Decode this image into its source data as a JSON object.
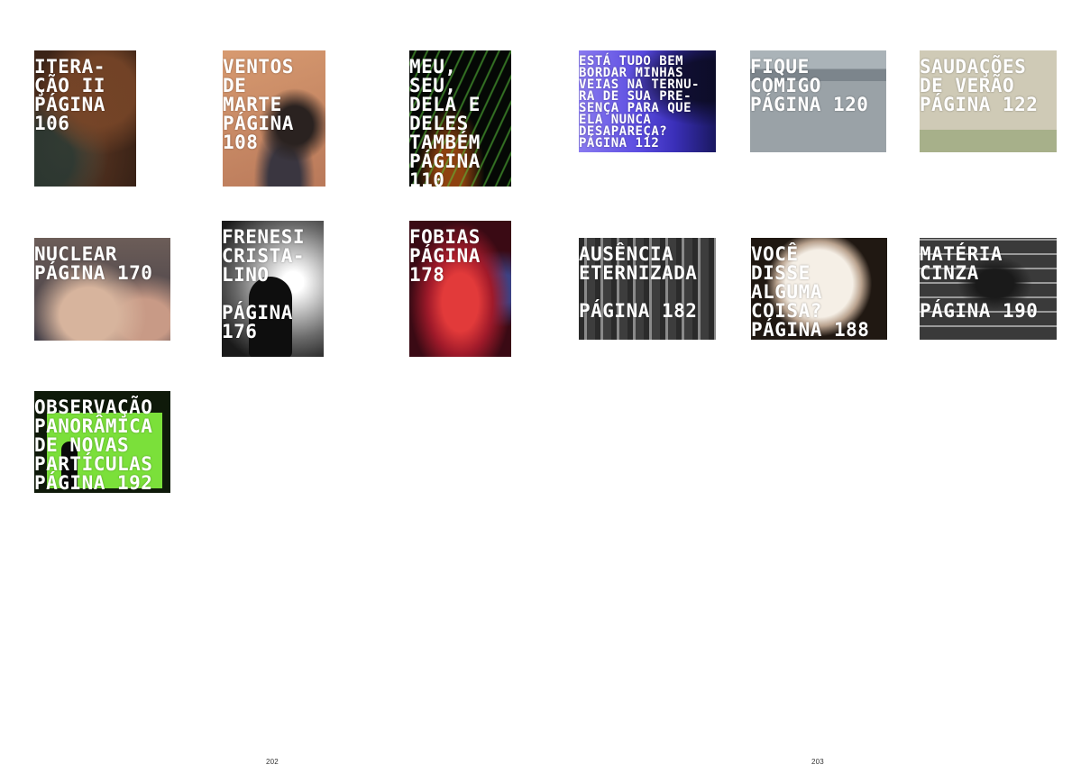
{
  "spread": {
    "page_left": "202",
    "page_right": "203"
  },
  "tiles": [
    {
      "caption": "ITERA-\nÇÃO II\nPÁGINA\n106",
      "image": "woman-drinking-photo"
    },
    {
      "caption": "VENTOS\nDE\nMARTE\nPÁGINA\n108",
      "image": "person-sitting-on-sand-photo"
    },
    {
      "caption": "MEU,\nSEU,\nDELA E\nDELES\nTAMBÉM\nPÁGINA\n110",
      "image": "green-light-streaks-photo"
    },
    {
      "caption": "ESTÁ TUDO BEM\nBORDAR MINHAS\nVEIAS NA TERNU-\nRA DE SUA PRE-\nSENÇA PARA QUE\nELA NUNCA\nDESAPAREÇA?\nPÁGINA 112",
      "image": "violet-blue-gradient-photo"
    },
    {
      "caption": "FIQUE\nCOMIGO\nPÁGINA 120",
      "image": "grey-wall-shadow-photo"
    },
    {
      "caption": "SAUDAÇÕES\nDE VERÃO\nPÁGINA 122",
      "image": "hazy-beach-photo"
    },
    {
      "caption": "NUCLEAR\nPÁGINA 170",
      "image": "hands-on-knees-photo"
    },
    {
      "caption": "FRENESI\nCRISTA-\nLINO\n\nPÁGINA\n176",
      "image": "silhouette-backlit-photo"
    },
    {
      "caption": "FOBIAS\nPÁGINA\n178",
      "image": "red-lit-face-photo"
    },
    {
      "caption": "AUSÊNCIA\nETERNIZADA\n\nPÁGINA 182",
      "image": "monochrome-street-photo"
    },
    {
      "caption": "VOCÊ\nDISSE\nALGUMA\nCOISA?\nPÁGINA 188",
      "image": "glowing-sphere-photo"
    },
    {
      "caption": "MATÉRIA\nCINZA\n\nPÁGINA 190",
      "image": "window-silhouette-photo"
    },
    {
      "caption": "OBSERVAÇÃO\nPANORÂMICA\nDE NOVAS\nPARTÍCULAS\nPÁGINA 192",
      "image": "green-screen-silhouette-photo"
    }
  ]
}
